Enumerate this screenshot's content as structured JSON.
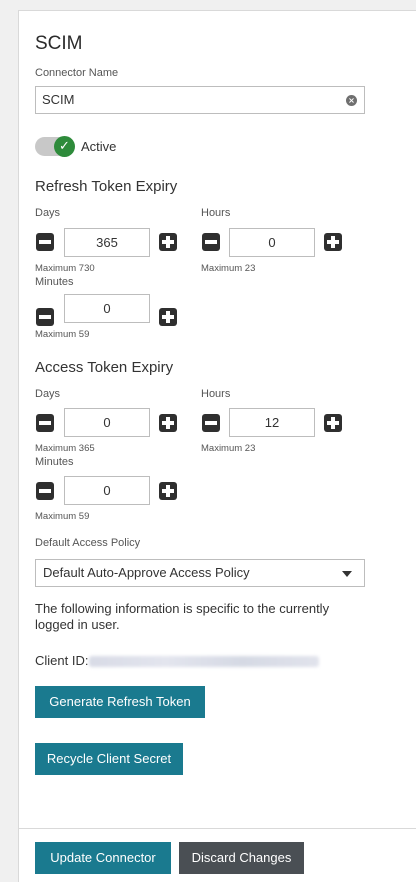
{
  "panel": {
    "title": "SCIM",
    "connector_name_label": "Connector Name",
    "connector_name_value": "SCIM",
    "active_label": "Active",
    "active": true
  },
  "refresh_token_expiry": {
    "heading": "Refresh Token Expiry",
    "days": {
      "label": "Days",
      "value": "365",
      "max": "Maximum 730"
    },
    "hours": {
      "label": "Hours",
      "value": "0",
      "max": "Maximum 23"
    },
    "minutes": {
      "label": "Minutes",
      "value": "0",
      "max": "Maximum 59"
    }
  },
  "access_token_expiry": {
    "heading": "Access Token Expiry",
    "days": {
      "label": "Days",
      "value": "0",
      "max": "Maximum 365"
    },
    "hours": {
      "label": "Hours",
      "value": "12",
      "max": "Maximum 23"
    },
    "minutes": {
      "label": "Minutes",
      "value": "0",
      "max": "Maximum 59"
    }
  },
  "policy": {
    "label": "Default Access Policy",
    "selected": "Default Auto-Approve Access Policy"
  },
  "info_text": "The following information is specific to the currently logged in user.",
  "client_id_label": "Client ID:",
  "buttons": {
    "generate_refresh_token": "Generate Refresh Token",
    "recycle_client_secret": "Recycle Client Secret",
    "update_connector": "Update Connector",
    "discard_changes": "Discard Changes"
  },
  "colors": {
    "primary_button": "#1a7a8f",
    "secondary_button": "#4a4f54",
    "toggle_on": "#2e8b3b"
  },
  "icons": {
    "clear": "clear-icon",
    "toggle": "check-icon",
    "minus": "minus-icon",
    "plus": "plus-icon",
    "dropdown": "chevron-down-icon"
  }
}
